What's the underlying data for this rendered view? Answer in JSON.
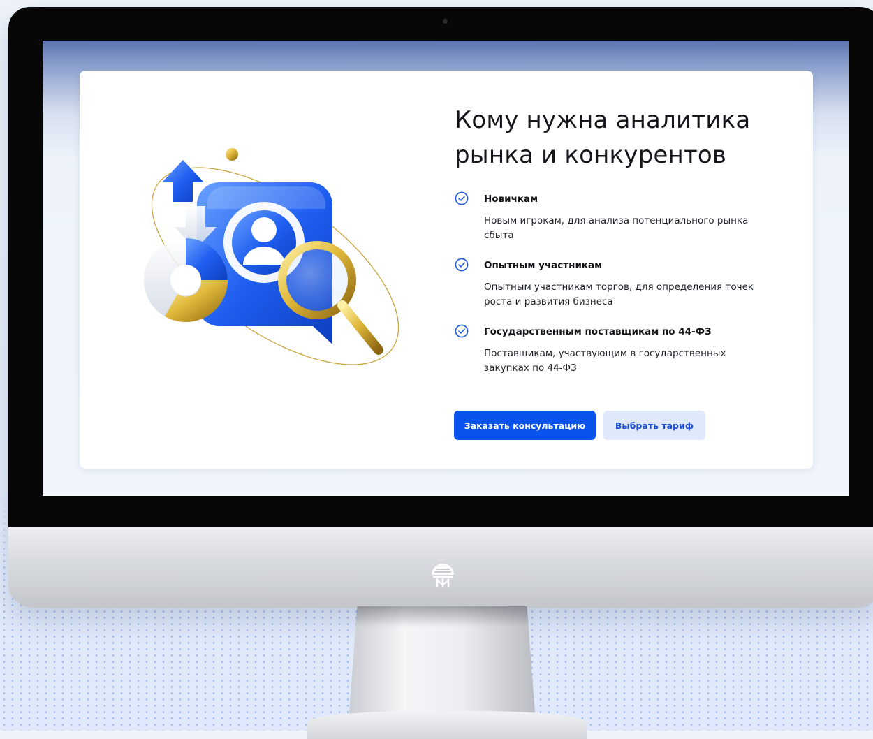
{
  "screen": {
    "title": "Кому нужна аналитика рынка и конкурентов",
    "items": [
      {
        "title": "Новичкам",
        "description": "Новым игрокам, для анализа потенциального рынка сбыта"
      },
      {
        "title": "Опытным участникам",
        "description": "Опытным участникам торгов, для определения точек роста и развития бизнеса"
      },
      {
        "title": "Государственным поставщикам по 44-ФЗ",
        "description": "Поставщикам, участвующим в государственных закупках по 44-ФЗ"
      }
    ],
    "buttons": {
      "primary_label": "Заказать консультацию",
      "secondary_label": "Выбрать тариф"
    }
  },
  "icons": {
    "check": "check-circle-icon",
    "illustration": "user-search-illustration",
    "logo": "brand-logo-icon"
  },
  "colors": {
    "accent": "#0a52ee",
    "secondary_button_bg": "#dfe9fb",
    "check_color": "#1f5be0"
  }
}
